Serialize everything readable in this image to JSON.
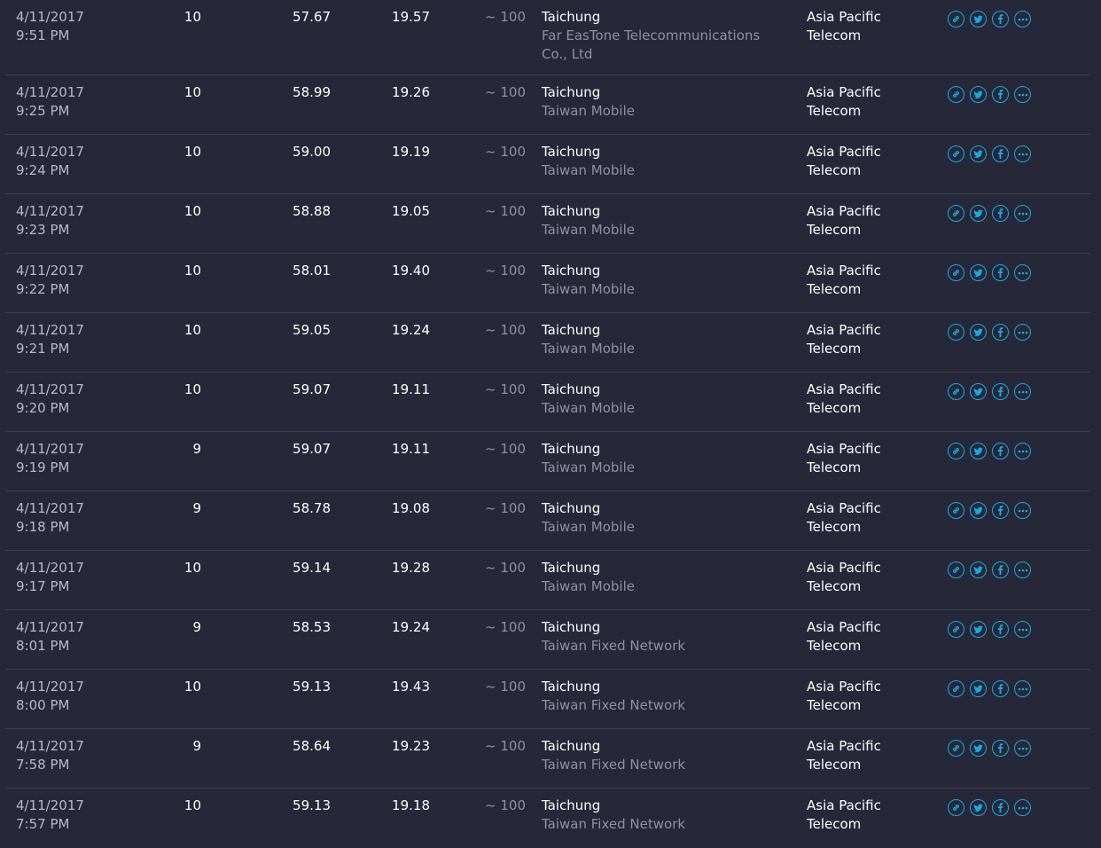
{
  "colors": {
    "background": "#26283a",
    "divider": "#3b3e52",
    "accent": "#1ca8dd",
    "muted_text": "#8e91a3"
  },
  "icons": [
    "link-icon",
    "twitter-icon",
    "facebook-icon",
    "more-icon"
  ],
  "results": [
    {
      "date": "4/11/2017",
      "time": "9:51 PM",
      "ping": "10",
      "download": "57.67",
      "upload": "19.57",
      "distance": "~ 100",
      "city": "Taichung",
      "server": "Far EasTone Telecommunications Co., Ltd",
      "isp_line1": "Asia Pacific",
      "isp_line2": "Telecom"
    },
    {
      "date": "4/11/2017",
      "time": "9:25 PM",
      "ping": "10",
      "download": "58.99",
      "upload": "19.26",
      "distance": "~ 100",
      "city": "Taichung",
      "server": "Taiwan Mobile",
      "isp_line1": "Asia Pacific",
      "isp_line2": "Telecom"
    },
    {
      "date": "4/11/2017",
      "time": "9:24 PM",
      "ping": "10",
      "download": "59.00",
      "upload": "19.19",
      "distance": "~ 100",
      "city": "Taichung",
      "server": "Taiwan Mobile",
      "isp_line1": "Asia Pacific",
      "isp_line2": "Telecom"
    },
    {
      "date": "4/11/2017",
      "time": "9:23 PM",
      "ping": "10",
      "download": "58.88",
      "upload": "19.05",
      "distance": "~ 100",
      "city": "Taichung",
      "server": "Taiwan Mobile",
      "isp_line1": "Asia Pacific",
      "isp_line2": "Telecom"
    },
    {
      "date": "4/11/2017",
      "time": "9:22 PM",
      "ping": "10",
      "download": "58.01",
      "upload": "19.40",
      "distance": "~ 100",
      "city": "Taichung",
      "server": "Taiwan Mobile",
      "isp_line1": "Asia Pacific",
      "isp_line2": "Telecom"
    },
    {
      "date": "4/11/2017",
      "time": "9:21 PM",
      "ping": "10",
      "download": "59.05",
      "upload": "19.24",
      "distance": "~ 100",
      "city": "Taichung",
      "server": "Taiwan Mobile",
      "isp_line1": "Asia Pacific",
      "isp_line2": "Telecom"
    },
    {
      "date": "4/11/2017",
      "time": "9:20 PM",
      "ping": "10",
      "download": "59.07",
      "upload": "19.11",
      "distance": "~ 100",
      "city": "Taichung",
      "server": "Taiwan Mobile",
      "isp_line1": "Asia Pacific",
      "isp_line2": "Telecom"
    },
    {
      "date": "4/11/2017",
      "time": "9:19 PM",
      "ping": "9",
      "download": "59.07",
      "upload": "19.11",
      "distance": "~ 100",
      "city": "Taichung",
      "server": "Taiwan Mobile",
      "isp_line1": "Asia Pacific",
      "isp_line2": "Telecom"
    },
    {
      "date": "4/11/2017",
      "time": "9:18 PM",
      "ping": "9",
      "download": "58.78",
      "upload": "19.08",
      "distance": "~ 100",
      "city": "Taichung",
      "server": "Taiwan Mobile",
      "isp_line1": "Asia Pacific",
      "isp_line2": "Telecom"
    },
    {
      "date": "4/11/2017",
      "time": "9:17 PM",
      "ping": "10",
      "download": "59.14",
      "upload": "19.28",
      "distance": "~ 100",
      "city": "Taichung",
      "server": "Taiwan Mobile",
      "isp_line1": "Asia Pacific",
      "isp_line2": "Telecom"
    },
    {
      "date": "4/11/2017",
      "time": "8:01 PM",
      "ping": "9",
      "download": "58.53",
      "upload": "19.24",
      "distance": "~ 100",
      "city": "Taichung",
      "server": "Taiwan Fixed Network",
      "isp_line1": "Asia Pacific",
      "isp_line2": "Telecom"
    },
    {
      "date": "4/11/2017",
      "time": "8:00 PM",
      "ping": "10",
      "download": "59.13",
      "upload": "19.43",
      "distance": "~ 100",
      "city": "Taichung",
      "server": "Taiwan Fixed Network",
      "isp_line1": "Asia Pacific",
      "isp_line2": "Telecom"
    },
    {
      "date": "4/11/2017",
      "time": "7:58 PM",
      "ping": "9",
      "download": "58.64",
      "upload": "19.23",
      "distance": "~ 100",
      "city": "Taichung",
      "server": "Taiwan Fixed Network",
      "isp_line1": "Asia Pacific",
      "isp_line2": "Telecom"
    },
    {
      "date": "4/11/2017",
      "time": "7:57 PM",
      "ping": "10",
      "download": "59.13",
      "upload": "19.18",
      "distance": "~ 100",
      "city": "Taichung",
      "server": "Taiwan Fixed Network",
      "isp_line1": "Asia Pacific",
      "isp_line2": "Telecom"
    }
  ]
}
